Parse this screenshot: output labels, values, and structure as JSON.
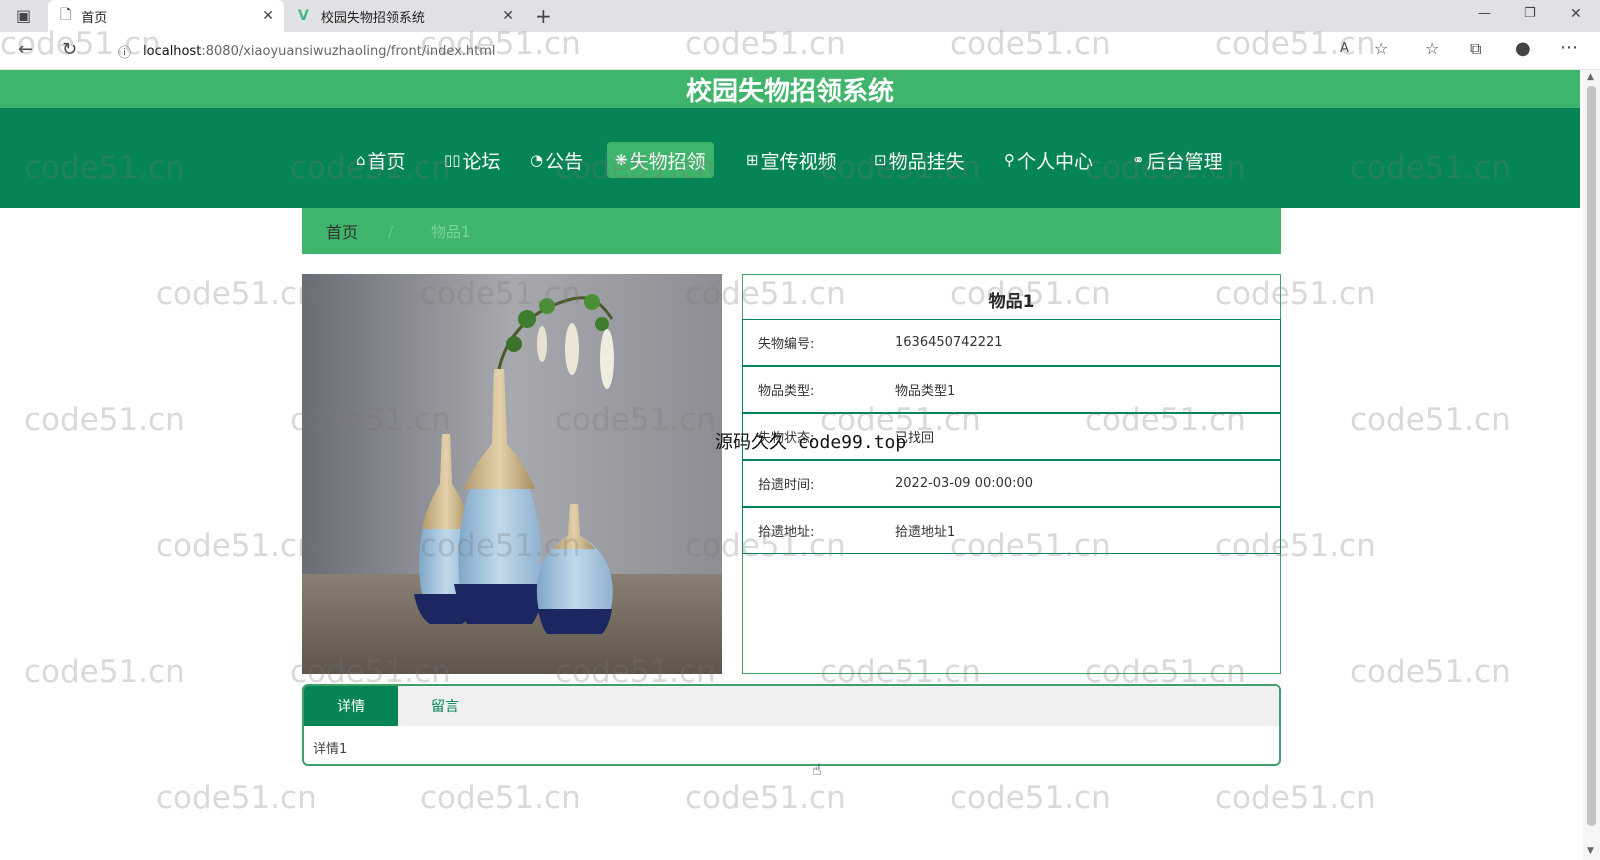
{
  "browser": {
    "tabs": [
      {
        "title": "首页",
        "icon": "page-icon"
      },
      {
        "title": "校园失物招领系统",
        "icon": "vue-logo-icon"
      }
    ],
    "new_tab": "+",
    "url_host": "localhost",
    "url_rest": ":8080/xiaoyuansiwuzhaoling/front/index.html",
    "controls": {
      "minimize": "—",
      "restore": "❐",
      "close": "✕"
    }
  },
  "site": {
    "title": "校园失物招领系统",
    "accent": "#3fb56b",
    "nav_bg": "#058556"
  },
  "nav": [
    {
      "icon": "⌂",
      "label": "首页"
    },
    {
      "icon": "▯▯",
      "label": "论坛"
    },
    {
      "icon": "◔",
      "label": "公告"
    },
    {
      "icon": "❋",
      "label": "失物招领",
      "active": true
    },
    {
      "icon": "⊞",
      "label": "宣传视频"
    },
    {
      "icon": "⊡",
      "label": "物品挂失"
    },
    {
      "icon": "⚲",
      "label": "个人中心"
    },
    {
      "icon": "⚭",
      "label": "后台管理"
    }
  ],
  "breadcrumb": {
    "home": "首页",
    "separator": "/",
    "current": "物品1"
  },
  "item": {
    "name": "物品1",
    "fields": [
      {
        "label": "失物编号:",
        "value": "1636450742221"
      },
      {
        "label": "物品类型:",
        "value": "物品类型1"
      },
      {
        "label": "失物状态:",
        "value": "已找回"
      },
      {
        "label": "拾遗时间:",
        "value": "2022-03-09 00:00:00"
      },
      {
        "label": "拾遗地址:",
        "value": "拾遗地址1"
      }
    ]
  },
  "tabs": {
    "detail": "详情",
    "message": "留言",
    "content": "详情1"
  },
  "overlay": "源码久久 code99.top",
  "watermark": "code51.cn"
}
